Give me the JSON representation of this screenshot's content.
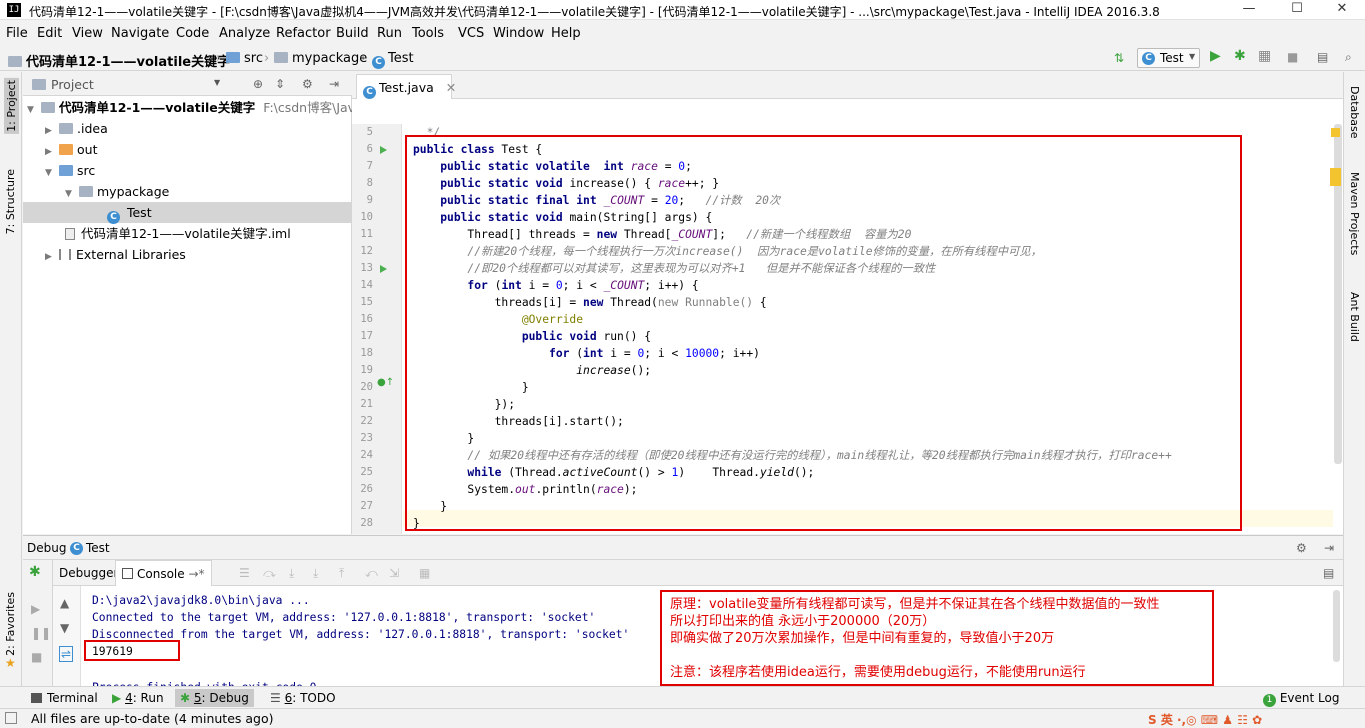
{
  "window": {
    "title": "代码清单12-1——volatile关键字 - [F:\\csdn博客\\Java虚拟机4——JVM高效并发\\代码清单12-1——volatile关键字] - [代码清单12-1——volatile关键字] - ...\\src\\mypackage\\Test.java - IntelliJ IDEA 2016.3.8",
    "app_icon": "IJ",
    "minimize": "—",
    "maximize": "☐",
    "close": "✕"
  },
  "menu": [
    "File",
    "Edit",
    "View",
    "Navigate",
    "Code",
    "Analyze",
    "Refactor",
    "Build",
    "Run",
    "Tools",
    "VCS",
    "Window",
    "Help"
  ],
  "breadcrumb": {
    "project": "代码清单12-1——volatile关键字",
    "src": "src",
    "package": "mypackage",
    "class": "Test"
  },
  "toolbar": {
    "run_config": "Test"
  },
  "left_tool_tabs": [
    "1: Project",
    "7: Structure",
    "2: Favorites"
  ],
  "right_tool_tabs": [
    "Database",
    "Maven Projects",
    "Ant Build"
  ],
  "project_panel": {
    "header": "Project",
    "tree": [
      {
        "label": "代码清单12-1——volatile关键字",
        "path": "F:\\csdn博客\\Java虚",
        "depth": 0,
        "expanded": true,
        "kind": "module"
      },
      {
        "label": ".idea",
        "depth": 1,
        "expanded": false,
        "kind": "folder"
      },
      {
        "label": "out",
        "depth": 1,
        "expanded": false,
        "kind": "folder-orange"
      },
      {
        "label": "src",
        "depth": 1,
        "expanded": true,
        "kind": "folder-blue"
      },
      {
        "label": "mypackage",
        "depth": 2,
        "expanded": true,
        "kind": "package"
      },
      {
        "label": "Test",
        "depth": 3,
        "kind": "class",
        "selected": true
      },
      {
        "label": "代码清单12-1——volatile关键字.iml",
        "depth": 1,
        "kind": "iml"
      },
      {
        "label": "External Libraries",
        "depth": 0,
        "expanded": false,
        "kind": "library"
      }
    ]
  },
  "editor": {
    "tab": "Test.java",
    "line_numbers": [
      "5",
      "6",
      "7",
      "8",
      "9",
      "10",
      "11",
      "12",
      "13",
      "14",
      "15",
      "16",
      "17",
      "18",
      "19",
      "20",
      "21",
      "22",
      "23",
      "24",
      "25",
      "26",
      "27",
      "28"
    ]
  },
  "debug": {
    "header_label": "Debug",
    "config": "Test",
    "tab_debugger": "Debugger",
    "tab_console": "Console",
    "console_lines": [
      "D:\\java2\\javajdk8.0\\bin\\java ...",
      "Connected to the target VM, address: '127.0.0.1:8818', transport: 'socket'",
      "Disconnected from the target VM, address: '127.0.0.1:8818', transport: 'socket'",
      "197619",
      "",
      "Process finished with exit code 0"
    ]
  },
  "annotation": {
    "line1": "原理：volatile变量所有线程都可读写，但是并不保证其在各个线程中数据值的一致性",
    "line2": "所以打印出来的值  永远小于200000（20万）",
    "line3": "即确实做了20万次累加操作，但是中间有重复的，导致值小于20万",
    "line4": "注意：该程序若使用idea运行，需要使用debug运行，不能使用run运行"
  },
  "bottom_tabs": [
    {
      "num": "",
      "label": "Terminal"
    },
    {
      "num": "4",
      "label": ": Run"
    },
    {
      "num": "5",
      "label": ": Debug"
    },
    {
      "num": "6",
      "label": ": TODO"
    }
  ],
  "event_log": "Event Log",
  "event_count": "1",
  "status": "All files are up-to-date (4 minutes ago)",
  "colors": {
    "annotation_red": "#e00000",
    "keyword": "#000080",
    "field": "#660e7a",
    "comment": "#808080"
  }
}
